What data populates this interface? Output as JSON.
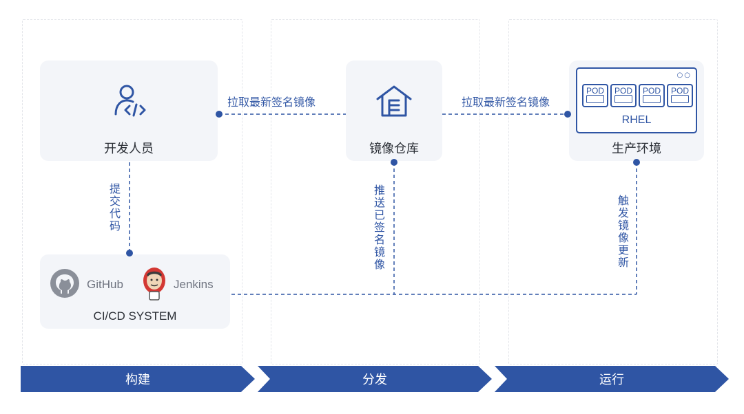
{
  "nodes": {
    "developer": {
      "label": "开发人员"
    },
    "registry": {
      "label": "镜像仓库"
    },
    "production": {
      "label": "生产环境",
      "rhel_label": "RHEL",
      "pod_label": "POD"
    },
    "cicd": {
      "label": "CI/CD SYSTEM",
      "github_label": "GitHub",
      "jenkins_label": "Jenkins"
    }
  },
  "edges": {
    "dev_to_registry": "拉取最新签名镜像",
    "registry_to_prod": "拉取最新签名镜像",
    "commit_code": "提交代码",
    "push_signed": "推送已签名镜像",
    "trigger_update": "触发镜像更新"
  },
  "stages": [
    "构建",
    "分发",
    "运行"
  ],
  "colors": {
    "accent": "#2f55a4",
    "stage_bar": "#2f55a4",
    "card_bg": "#f3f5f9"
  },
  "icons": {
    "developer": "developer-code-icon",
    "registry": "warehouse-icon",
    "github": "github-icon",
    "jenkins": "jenkins-icon"
  }
}
